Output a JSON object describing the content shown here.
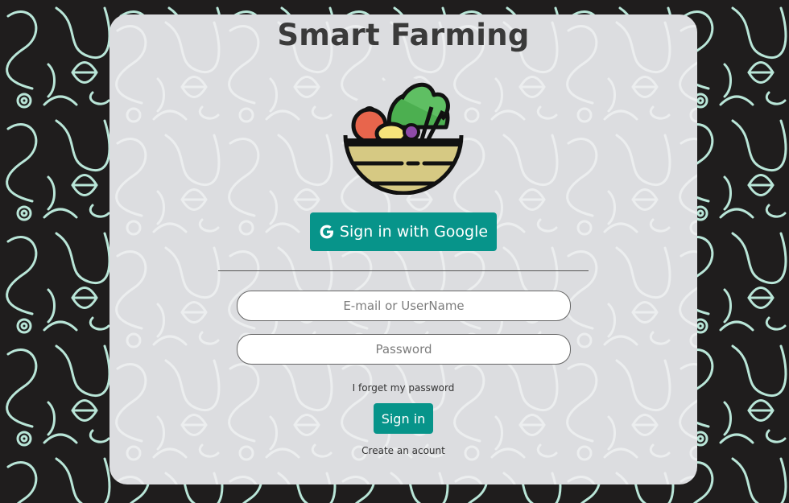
{
  "app": {
    "title": "Smart Farming"
  },
  "logo": {
    "icon": "vegetable-basket-icon"
  },
  "auth": {
    "google_button_label": "Sign in with Google",
    "google_icon": "google-g-icon",
    "email_placeholder": "E-mail or UserName",
    "password_placeholder": "Password",
    "forgot_password_link": "I forget my password",
    "sign_in_label": "Sign in",
    "create_account_link": "Create an acount"
  },
  "colors": {
    "accent": "#07948a",
    "card_background": "#dcdde0",
    "page_background": "#1f1d1d",
    "pattern_stroke": "#b9e6d8"
  }
}
